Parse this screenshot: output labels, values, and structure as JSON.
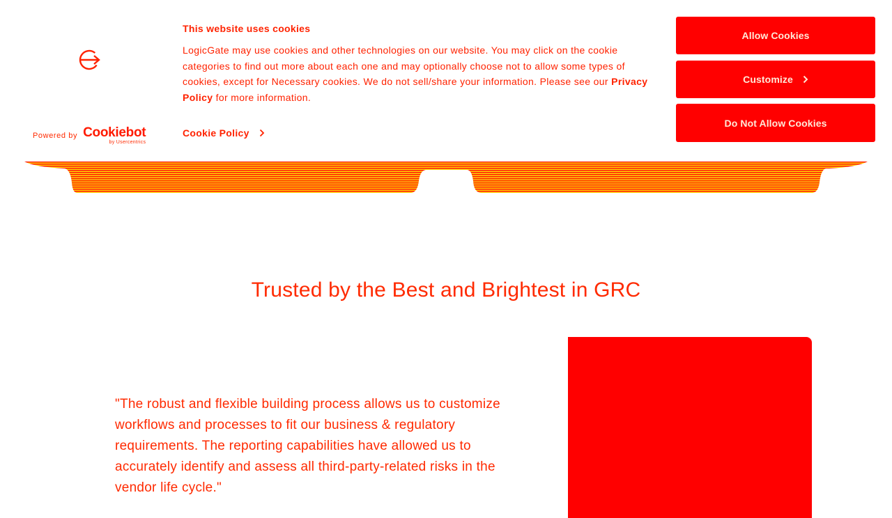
{
  "cookie_banner": {
    "title": "This website uses cookies",
    "body_before_link": "LogicGate may use cookies and other technologies on our website. You may click on the cookie categories to find out more about each one and may optionally choose not to allow some types of cookies, except for Necessary cookies.  We do not sell/share your information. Please see our ",
    "privacy_link": "Privacy Policy",
    "body_after_link": " for more information.",
    "cookie_policy_link": "Cookie Policy",
    "powered_by": "Powered by",
    "cookiebot_name": "Cookiebot",
    "cookiebot_by": "by Usercentrics",
    "buttons": {
      "allow": "Allow Cookies",
      "customize": "Customize",
      "deny": "Do Not Allow Cookies"
    }
  },
  "main": {
    "section_title": "Trusted by the Best and Brightest in GRC",
    "quote": "\"The robust and flexible building process allows us to customize workflows and processes to fit our business & regulatory requirements. The reporting capabilities have allowed us to accurately identify and assess all third-party-related risks in the vendor life cycle.\""
  },
  "colors": {
    "accent": "#ff0000",
    "text": "#ff2200",
    "button_text": "#ffe9d8",
    "background": "#ffffff"
  },
  "icons": {
    "logo": "logicgate-logo-icon",
    "chevron": "chevron-right-icon"
  }
}
